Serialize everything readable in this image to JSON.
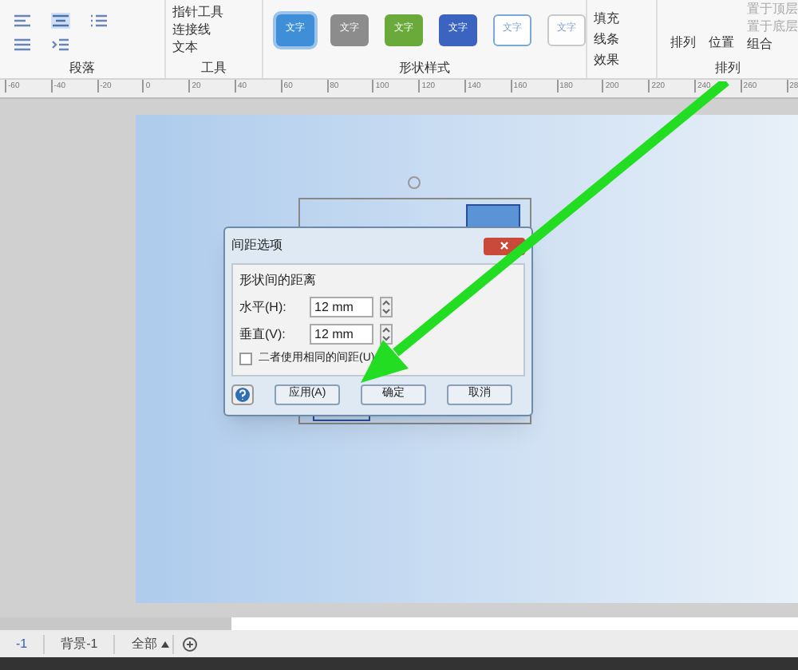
{
  "ribbon": {
    "groups": [
      {
        "label": "段落"
      },
      {
        "label": "工具"
      },
      {
        "label": "形状样式"
      },
      {
        "label": "排列"
      }
    ],
    "tools": [
      "指针工具",
      "连接线",
      "文本"
    ],
    "styles": [
      {
        "label": "文字",
        "color": "#3f8fd8",
        "selected": true
      },
      {
        "label": "文字",
        "color": "#8c8c8c",
        "selected": false
      },
      {
        "label": "文字",
        "color": "#6aaa3a",
        "selected": false
      },
      {
        "label": "文字",
        "color": "#3a64c0",
        "selected": false
      },
      {
        "label": "文字",
        "color": "#ffffff",
        "selected": false
      },
      {
        "label": "文字",
        "color": "#fdfdfd",
        "selected": false
      }
    ],
    "style_options": [
      "填充",
      "线条",
      "效果"
    ],
    "arrange": [
      "排列",
      "位置"
    ],
    "arrange_small": [
      "置于顶层",
      "置于底层",
      "组合"
    ]
  },
  "ruler": [
    "-60",
    "-40",
    "-20",
    "0",
    "20",
    "40",
    "60",
    "80",
    "100",
    "120",
    "140",
    "160",
    "180",
    "200",
    "220",
    "240",
    "260",
    "28"
  ],
  "dialog": {
    "title": "间距选项",
    "group": "形状间的距离",
    "fields": [
      {
        "label": "水平(H):",
        "value": "12 mm"
      },
      {
        "label": "垂直(V):",
        "value": "12 mm"
      }
    ],
    "checkbox": {
      "label": "二者使用相同的间距(U)",
      "checked": false
    },
    "buttons": [
      "应用(A)",
      "确定",
      "取消"
    ]
  },
  "page_tabs": [
    {
      "label": "-1",
      "selected": true
    },
    {
      "label": "背景-1",
      "selected": false
    },
    {
      "label": "全部",
      "selected": false
    }
  ]
}
